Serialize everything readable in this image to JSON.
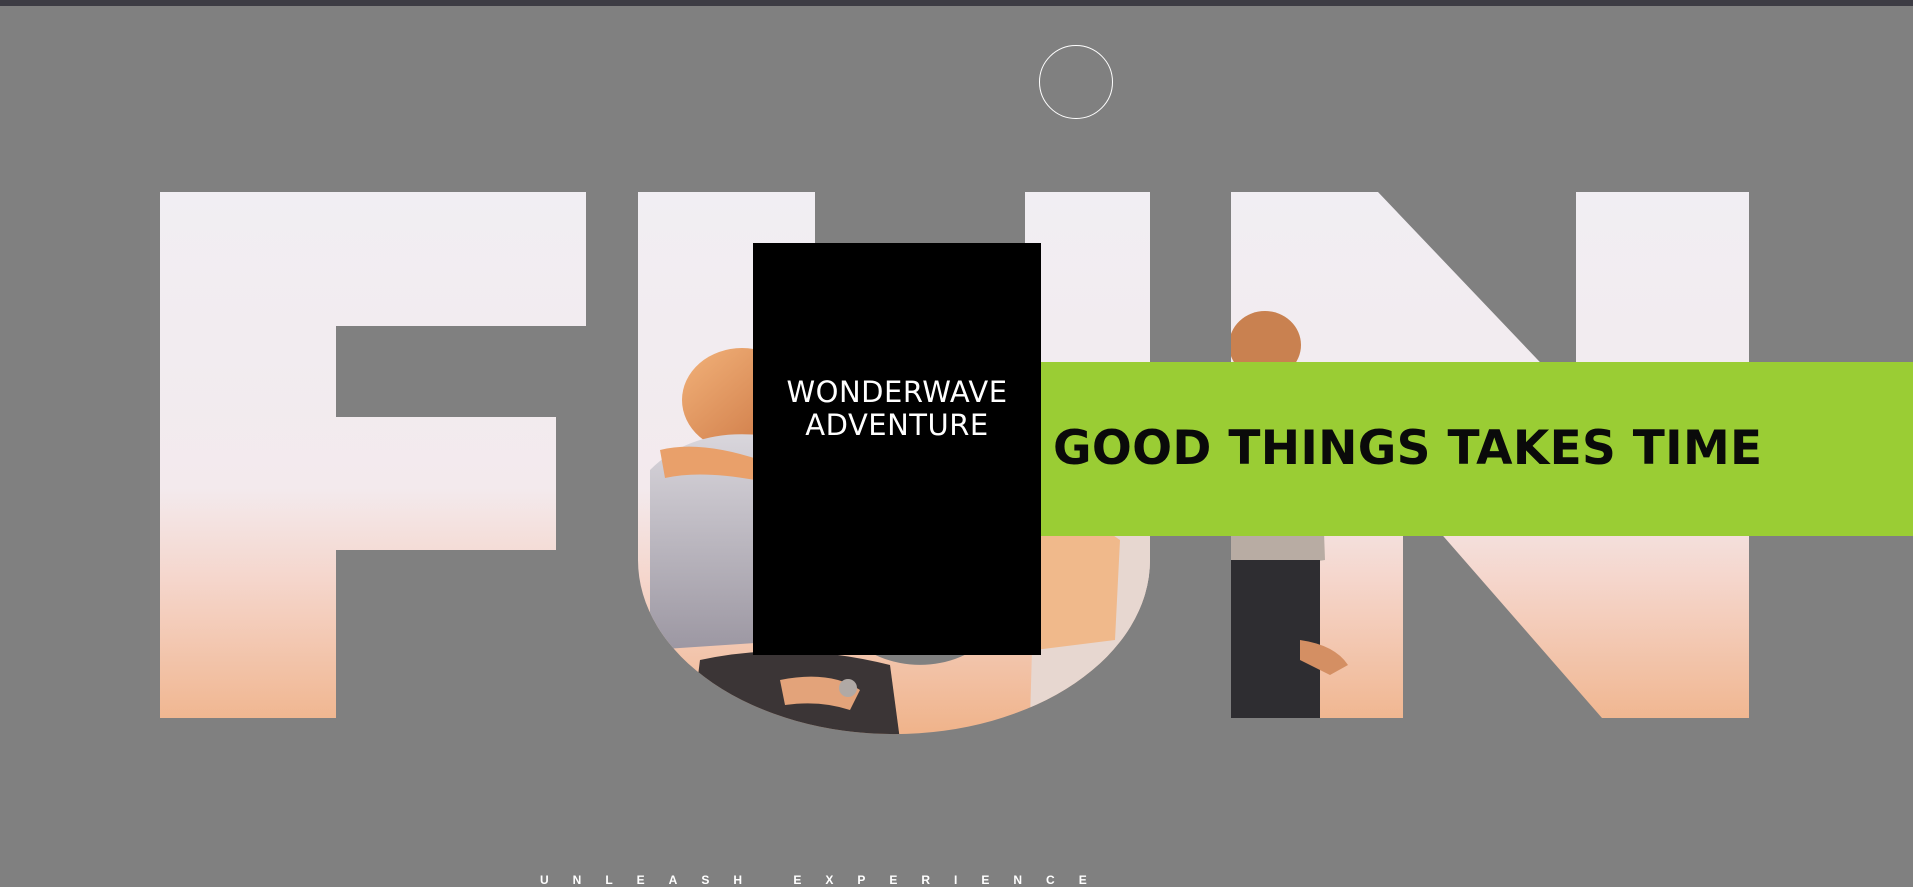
{
  "hero": {
    "word": "FUN",
    "card_title_line1": "WONDERWAVE",
    "card_title_line2": "ADVENTURE",
    "banner_text": "GOOD THINGS TAKES TIME",
    "tagline": "UNLEASH EXPERIENCE"
  },
  "colors": {
    "background": "#808080",
    "topbar": "#3d3c44",
    "banner": "#9acd34",
    "card": "#000000",
    "letter_sky": "#f1eef3",
    "letter_glow": "#f3bf9a"
  },
  "icons": {
    "cursor": "circle-outline-icon"
  }
}
